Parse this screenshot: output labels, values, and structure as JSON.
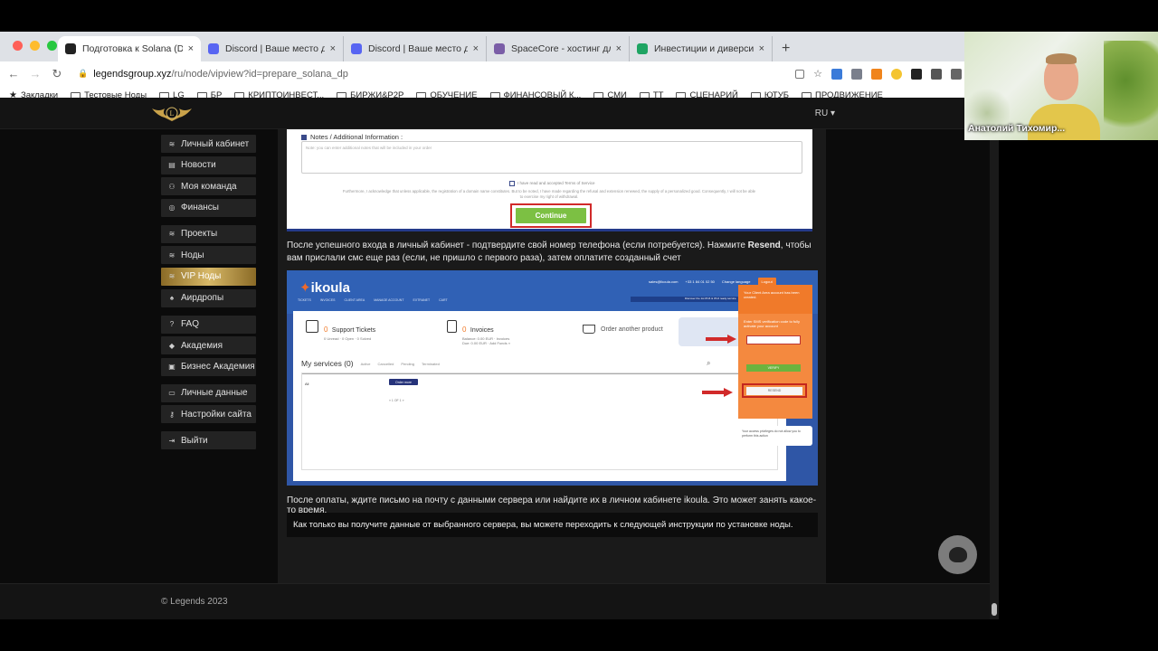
{
  "browser": {
    "tabs": [
      {
        "title": "Подготовка к Solana (Delegat",
        "active": true,
        "icon": "legends-icon",
        "color": "#222222"
      },
      {
        "title": "Discord | Ваше место для общ",
        "active": false,
        "icon": "discord-icon",
        "color": "#5865f2"
      },
      {
        "title": "Discord | Ваше место для общ",
        "active": false,
        "icon": "discord-icon",
        "color": "#5865f2"
      },
      {
        "title": "SpaceCore - хостинг для всех",
        "active": false,
        "icon": "spacecore-icon",
        "color": "#7b5ea7"
      },
      {
        "title": "Инвестиции и диверсификаци",
        "active": false,
        "icon": "sheets-icon",
        "color": "#1fa463"
      }
    ],
    "url_host": "legendsgroup.xyz",
    "url_path": "/ru/node/vipview?id=prepare_solana_dp",
    "bookmarks": [
      "Закладки",
      "Тестовые Ноды",
      "LG",
      "БР",
      "КРИПТОИНВЕСТ...",
      "БИРЖИ&P2P",
      "ОБУЧЕНИЕ",
      "ФИНАНСОВЫЙ К...",
      "СМИ",
      "ТТ",
      "СЦЕНАРИЙ",
      "ЮТУБ",
      "ПРОДВИЖЕНИЕ"
    ]
  },
  "site": {
    "lang": "RU",
    "nav": [
      {
        "label": "Личный кабинет",
        "icon": "layers-icon"
      },
      {
        "label": "Новости",
        "icon": "news-icon"
      },
      {
        "label": "Моя команда",
        "icon": "team-icon"
      },
      {
        "label": "Финансы",
        "icon": "coins-icon"
      },
      {
        "label": "Проекты",
        "icon": "layers-icon"
      },
      {
        "label": "Ноды",
        "icon": "layers-icon"
      },
      {
        "label": "VIP Ноды",
        "icon": "layers-icon"
      },
      {
        "label": "Аирдропы",
        "icon": "parachute-icon"
      },
      {
        "label": "FAQ",
        "icon": "question-icon"
      },
      {
        "label": "Академия",
        "icon": "graduation-icon"
      },
      {
        "label": "Бизнес Академия",
        "icon": "briefcase-icon"
      },
      {
        "label": "Личные данные",
        "icon": "id-card-icon"
      },
      {
        "label": "Настройки сайта",
        "icon": "key-icon"
      },
      {
        "label": "Выйти",
        "icon": "logout-icon"
      }
    ],
    "screenshot1": {
      "notes_label": "Notes / Additional Information :",
      "notes_placeholder": "Note: you can enter additional notes that will be included in your order",
      "tos": "I have read and accepted Terms of Service",
      "legal": "Furthermore, I acknowledge that unless applicable, the registration of a domain name constitutes. But to be noted, I have made regarding the refusal and extension renewed, the supply of a personalized good. Consequently, I will not be able to exercise my right of withdrawal.",
      "continue": "Continue"
    },
    "para1_a": "После успешного входа в личный кабинет - подтвердите свой номер телефона (если потребуется). Нажмите ",
    "para1_bold": "Resend",
    "para1_b": ", чтобы вам прислали смс еще раз (если, не пришло с первого раза), затем оплатите созданный счет",
    "screenshot2": {
      "logo": "ikoula",
      "menu": [
        "TICKETS",
        "INVOICES",
        "CLIENT AREA",
        "MANAGE ACCOUNT",
        "EXTRANET",
        "CART"
      ],
      "email": "sales@ikoula.com",
      "phone": "+33 1 84 01 02 50",
      "change_lang": "Change language",
      "logout": "Logout",
      "strip": "Discover the 1st IPv6 & IPv4 ready service",
      "tickets_num": "0",
      "tickets_label": "Support Tickets",
      "tickets_sub": "0 Unread · 0 Open · 0 Solved",
      "invoices_num": "0",
      "invoices_label": "Invoices",
      "invoices_sub": "Balance: 0.00 EUR · Invoices Due: 0.00 EUR · Add Funds »",
      "order": "Order another product",
      "services_title": "My services (0)",
      "filters": [
        "Active",
        "Cancelled",
        "Pending",
        "Terminated"
      ],
      "table_cell": "All",
      "order_more": "Order more",
      "pager": "« 1 OF 1 »",
      "panel_top": "Your Client Area account has been created.",
      "panel_text": "Enter SMS verification code to fully activate your account",
      "verify": "VERIFY",
      "resend": "RESEND",
      "note": "Your access privileges do not allow you to perform this action"
    },
    "para2": "После оплаты, ждите письмо на почту с данными сервера или найдите их в личном кабинете ikoula. Это может занять какое-то время.",
    "notice": "Как только вы получите данные от выбранного сервера, вы можете переходить к следующей инструкции по установке ноды.",
    "copyright": "© Legends 2023"
  },
  "webcam": {
    "name": "Анатолий Тихомир..."
  },
  "colors": {
    "accent_gold": "#d7b867",
    "continue_green": "#7cc043",
    "highlight_red": "#d12a2a",
    "ikoula_blue": "#3061b5",
    "ikoula_orange": "#f07a2a"
  }
}
